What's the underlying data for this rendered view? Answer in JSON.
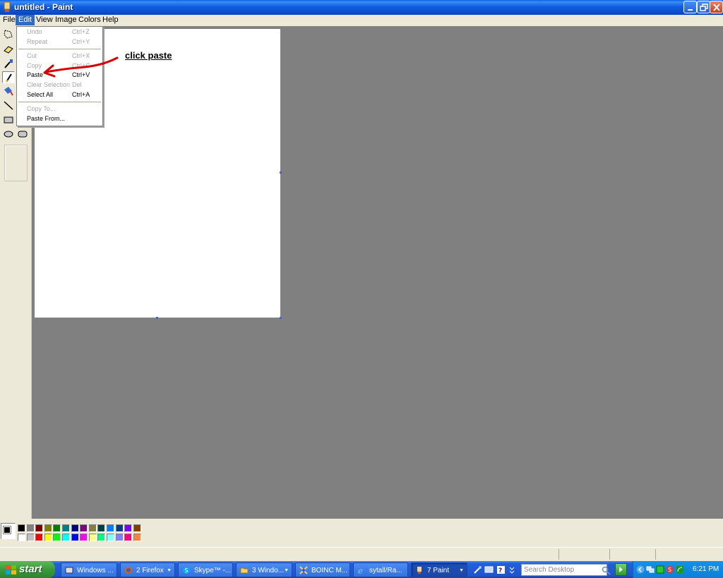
{
  "window": {
    "title": "untitled - Paint"
  },
  "menubar": {
    "items": [
      {
        "label": "File"
      },
      {
        "label": "Edit"
      },
      {
        "label": "View"
      },
      {
        "label": "Image"
      },
      {
        "label": "Colors"
      },
      {
        "label": "Help"
      }
    ]
  },
  "edit_menu": {
    "undo": {
      "label": "Undo",
      "shortcut": "Ctrl+Z",
      "enabled": false
    },
    "repeat": {
      "label": "Repeat",
      "shortcut": "Ctrl+Y",
      "enabled": false
    },
    "cut": {
      "label": "Cut",
      "shortcut": "Ctrl+X",
      "enabled": false
    },
    "copy": {
      "label": "Copy",
      "shortcut": "Ctrl+C",
      "enabled": false
    },
    "paste": {
      "label": "Paste",
      "shortcut": "Ctrl+V",
      "enabled": true
    },
    "clear_selection": {
      "label": "Clear Selection",
      "shortcut": "Del",
      "enabled": false
    },
    "select_all": {
      "label": "Select All",
      "shortcut": "Ctrl+A",
      "enabled": true
    },
    "copy_to": {
      "label": "Copy To...",
      "enabled": false
    },
    "paste_from": {
      "label": "Paste From...",
      "enabled": true
    }
  },
  "annotation": {
    "text": "click paste",
    "color": "#d40000"
  },
  "toolbox": {
    "tools": [
      "free-form-select-icon",
      "eraser-icon",
      "color-picker-icon",
      "pencil-icon",
      "brush-icon",
      "fill-icon",
      "line-icon",
      "rectangle-icon",
      "ellipse-icon",
      "rounded-rectangle-icon"
    ],
    "selected": "pencil-icon"
  },
  "palette": {
    "foreground": "#000000",
    "background": "#ffffff",
    "colors": [
      "#000000",
      "#808080",
      "#800000",
      "#808000",
      "#008000",
      "#008080",
      "#000080",
      "#800080",
      "#808040",
      "#004040",
      "#0080ff",
      "#004080",
      "#8000ff",
      "#804000",
      "#ffffff",
      "#c0c0c0",
      "#ff0000",
      "#ffff00",
      "#00ff00",
      "#00ffff",
      "#0000ff",
      "#ff00ff",
      "#ffff80",
      "#00ff80",
      "#80ffff",
      "#8080ff",
      "#ff0080",
      "#ff8040"
    ]
  },
  "taskbar": {
    "start_label": "start",
    "tasks": [
      {
        "label": "Windows ...",
        "icon": "windows-explorer-icon",
        "active": false,
        "group": false
      },
      {
        "label": "2 Firefox",
        "icon": "firefox-icon",
        "active": false,
        "group": true
      },
      {
        "label": "Skype™ -...",
        "icon": "skype-icon",
        "active": false,
        "group": false
      },
      {
        "label": "3 Windo...",
        "icon": "folder-icon",
        "active": false,
        "group": true
      },
      {
        "label": "BOINC M...",
        "icon": "boinc-icon",
        "active": false,
        "group": false
      },
      {
        "label": "sytall/Ra...",
        "icon": "internet-explorer-icon",
        "active": false,
        "group": false
      },
      {
        "label": "7 Paint",
        "icon": "paint-icon",
        "active": true,
        "group": true
      }
    ],
    "search_placeholder": "Search Desktop",
    "clock": "6:21 PM"
  }
}
